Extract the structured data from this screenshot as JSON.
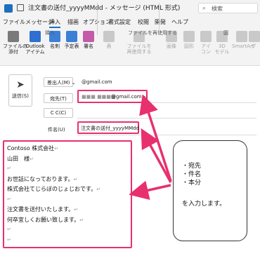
{
  "window": {
    "title": "注文書の送付_yyyyMMdd - メッセージ (HTML 形式)",
    "search_placeholder": "検索"
  },
  "menu": {
    "items": [
      "ファイル",
      "メッセージ",
      "挿入",
      "描画",
      "オプション",
      "書式設定",
      "校閲",
      "開発",
      "ヘルプ"
    ],
    "active": "挿入"
  },
  "ribbon": {
    "buttons": [
      {
        "label": "ファイルの\n添付",
        "icon": "attach-file-icon",
        "color": "#7a7a7a"
      },
      {
        "label": "Outlook\nアイテム",
        "icon": "outlook-item-icon",
        "color": "#2e6fd1"
      },
      {
        "label": "名刺",
        "icon": "business-card-icon",
        "color": "#3b7fd6"
      },
      {
        "label": "予定表",
        "icon": "calendar-icon",
        "color": "#3b7fd6"
      },
      {
        "label": "署名",
        "icon": "signature-icon",
        "color": "#c45ba8"
      },
      {
        "label": "表",
        "icon": "table-icon",
        "color": "#c9c9c9"
      },
      {
        "label": "ファイルを\n再使用する",
        "icon": "reuse-file-icon",
        "color": "#c9c9c9"
      },
      {
        "label": "画像",
        "icon": "picture-icon",
        "color": "#c9c9c9"
      },
      {
        "label": "図形",
        "icon": "shapes-icon",
        "color": "#c9c9c9"
      },
      {
        "label": "アイ\nコン",
        "icon": "icons-icon",
        "color": "#c9c9c9"
      },
      {
        "label": "3D\nモデル",
        "icon": "3d-model-icon",
        "color": "#c9c9c9"
      },
      {
        "label": "SmartArt",
        "icon": "smartart-icon",
        "color": "#c9c9c9"
      },
      {
        "label": "グ",
        "icon": "chart-icon",
        "color": "#c9c9c9"
      }
    ],
    "groups": {
      "insert": "挿入",
      "reuse": "ファイルを再使用する",
      "figure": "図"
    }
  },
  "compose": {
    "send_label": "送信(S)",
    "from_label": "差出人(M)",
    "from_value": "@gmail.com",
    "to_label": "宛先(T)",
    "to_value": "@gmail.com>;",
    "cc_label": "C C(C)",
    "subject_label": "件名(U)",
    "subject_value": "注文書の送付_yyyyMMdd"
  },
  "body": {
    "lines": [
      "Contoso 株式会社",
      "山田　様",
      "",
      "お世話になっております。",
      "株式会社てじらぼのじょじおです。",
      "",
      "注文書を送付いたします。",
      "何卒宜しくお願い致します。",
      "",
      ""
    ]
  },
  "callout": {
    "items": [
      "・宛先",
      "・件名",
      "・本分"
    ],
    "note": "を入力します。"
  },
  "colors": {
    "highlight": "#e8306e",
    "accent": "#1f6fbf"
  }
}
